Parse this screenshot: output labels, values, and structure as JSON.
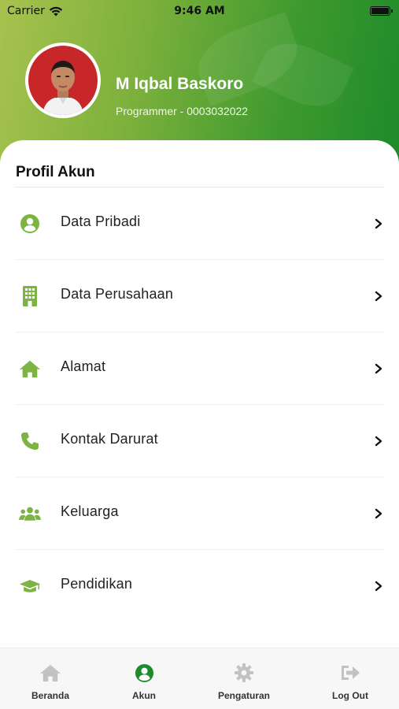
{
  "status_bar": {
    "carrier": "Carrier",
    "time": "9:46 AM"
  },
  "profile": {
    "name": "M Iqbal Baskoro",
    "subtitle": "Programmer - 0003032022"
  },
  "section": {
    "title": "Profil Akun"
  },
  "menu": [
    {
      "label": "Data Pribadi",
      "icon": "user-circle-icon"
    },
    {
      "label": "Data Perusahaan",
      "icon": "building-icon"
    },
    {
      "label": "Alamat",
      "icon": "home-icon"
    },
    {
      "label": "Kontak Darurat",
      "icon": "phone-icon"
    },
    {
      "label": "Keluarga",
      "icon": "users-icon"
    },
    {
      "label": "Pendidikan",
      "icon": "graduation-cap-icon"
    }
  ],
  "tabs": [
    {
      "label": "Beranda",
      "icon": "home-icon",
      "active": false
    },
    {
      "label": "Akun",
      "icon": "user-circle-icon",
      "active": true
    },
    {
      "label": "Pengaturan",
      "icon": "gear-icon",
      "active": false
    },
    {
      "label": "Log Out",
      "icon": "logout-icon",
      "active": false
    }
  ],
  "colors": {
    "accent": "#7cb342",
    "active_tab": "#1e8a2e",
    "inactive_tab": "#c2c2c2"
  }
}
